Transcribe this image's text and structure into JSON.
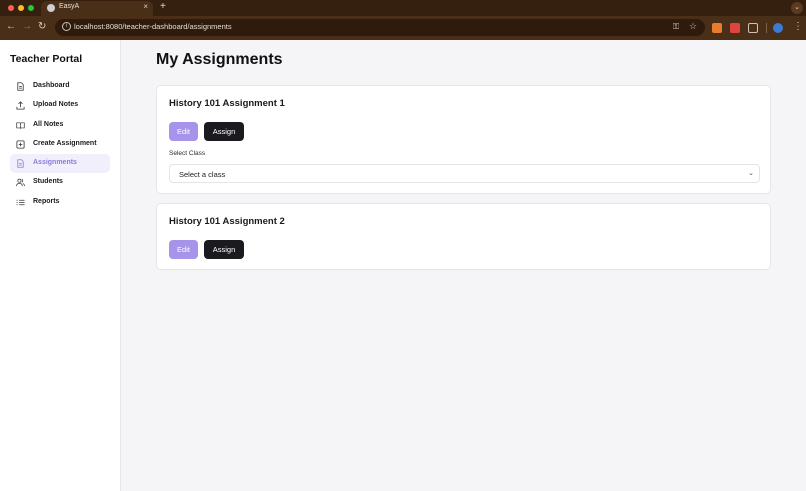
{
  "browser": {
    "tab_title": "EasyA",
    "tab_close": "×",
    "new_tab": "+",
    "url": "localhost:8080/teacher-dashboard/assignments",
    "icons": [
      "back-icon",
      "forward-icon",
      "reload-icon",
      "site-info-icon",
      "password-key-icon",
      "bookmark-star-icon",
      "extension-fox-icon",
      "extension-red-icon",
      "extensions-puzzle-icon",
      "profile-icon",
      "menu-icon"
    ]
  },
  "sidebar": {
    "title": "Teacher Portal",
    "items": [
      {
        "label": "Dashboard",
        "icon": "document-icon",
        "active": false
      },
      {
        "label": "Upload Notes",
        "icon": "upload-icon",
        "active": false
      },
      {
        "label": "All Notes",
        "icon": "book-icon",
        "active": false
      },
      {
        "label": "Create Assignment",
        "icon": "plus-square-icon",
        "active": false
      },
      {
        "label": "Assignments",
        "icon": "file-icon",
        "active": true
      },
      {
        "label": "Students",
        "icon": "users-icon",
        "active": false
      },
      {
        "label": "Reports",
        "icon": "list-icon",
        "active": false
      }
    ]
  },
  "main": {
    "title": "My Assignments",
    "assignments": [
      {
        "title": "History 101 Assignment 1",
        "edit_label": "Edit",
        "assign_label": "Assign",
        "select_label": "Select Class",
        "select_value": "Select a class"
      },
      {
        "title": "History 101 Assignment 2",
        "edit_label": "Edit",
        "assign_label": "Assign"
      }
    ]
  },
  "colors": {
    "accent": "#a594ea",
    "accent_text": "#8d7bd9",
    "dark_button": "#1b1b1f",
    "browser_chrome": "#4a2f18"
  }
}
